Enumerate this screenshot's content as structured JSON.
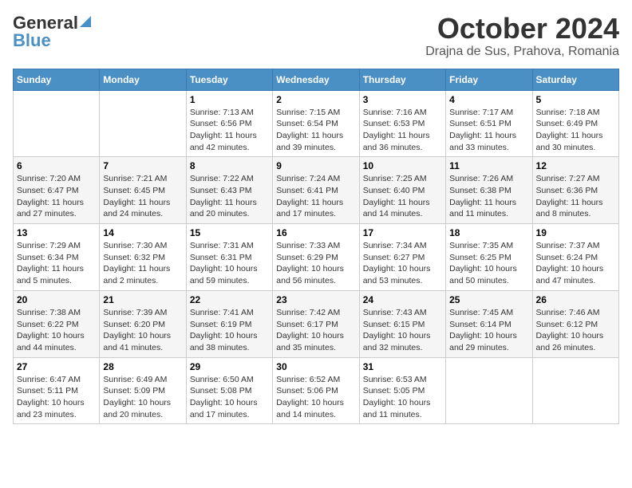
{
  "header": {
    "logo_line1": "General",
    "logo_line2": "Blue",
    "month": "October 2024",
    "location": "Drajna de Sus, Prahova, Romania"
  },
  "days_of_week": [
    "Sunday",
    "Monday",
    "Tuesday",
    "Wednesday",
    "Thursday",
    "Friday",
    "Saturday"
  ],
  "weeks": [
    [
      {
        "day": "",
        "info": ""
      },
      {
        "day": "",
        "info": ""
      },
      {
        "day": "1",
        "info": "Sunrise: 7:13 AM\nSunset: 6:56 PM\nDaylight: 11 hours and 42 minutes."
      },
      {
        "day": "2",
        "info": "Sunrise: 7:15 AM\nSunset: 6:54 PM\nDaylight: 11 hours and 39 minutes."
      },
      {
        "day": "3",
        "info": "Sunrise: 7:16 AM\nSunset: 6:53 PM\nDaylight: 11 hours and 36 minutes."
      },
      {
        "day": "4",
        "info": "Sunrise: 7:17 AM\nSunset: 6:51 PM\nDaylight: 11 hours and 33 minutes."
      },
      {
        "day": "5",
        "info": "Sunrise: 7:18 AM\nSunset: 6:49 PM\nDaylight: 11 hours and 30 minutes."
      }
    ],
    [
      {
        "day": "6",
        "info": "Sunrise: 7:20 AM\nSunset: 6:47 PM\nDaylight: 11 hours and 27 minutes."
      },
      {
        "day": "7",
        "info": "Sunrise: 7:21 AM\nSunset: 6:45 PM\nDaylight: 11 hours and 24 minutes."
      },
      {
        "day": "8",
        "info": "Sunrise: 7:22 AM\nSunset: 6:43 PM\nDaylight: 11 hours and 20 minutes."
      },
      {
        "day": "9",
        "info": "Sunrise: 7:24 AM\nSunset: 6:41 PM\nDaylight: 11 hours and 17 minutes."
      },
      {
        "day": "10",
        "info": "Sunrise: 7:25 AM\nSunset: 6:40 PM\nDaylight: 11 hours and 14 minutes."
      },
      {
        "day": "11",
        "info": "Sunrise: 7:26 AM\nSunset: 6:38 PM\nDaylight: 11 hours and 11 minutes."
      },
      {
        "day": "12",
        "info": "Sunrise: 7:27 AM\nSunset: 6:36 PM\nDaylight: 11 hours and 8 minutes."
      }
    ],
    [
      {
        "day": "13",
        "info": "Sunrise: 7:29 AM\nSunset: 6:34 PM\nDaylight: 11 hours and 5 minutes."
      },
      {
        "day": "14",
        "info": "Sunrise: 7:30 AM\nSunset: 6:32 PM\nDaylight: 11 hours and 2 minutes."
      },
      {
        "day": "15",
        "info": "Sunrise: 7:31 AM\nSunset: 6:31 PM\nDaylight: 10 hours and 59 minutes."
      },
      {
        "day": "16",
        "info": "Sunrise: 7:33 AM\nSunset: 6:29 PM\nDaylight: 10 hours and 56 minutes."
      },
      {
        "day": "17",
        "info": "Sunrise: 7:34 AM\nSunset: 6:27 PM\nDaylight: 10 hours and 53 minutes."
      },
      {
        "day": "18",
        "info": "Sunrise: 7:35 AM\nSunset: 6:25 PM\nDaylight: 10 hours and 50 minutes."
      },
      {
        "day": "19",
        "info": "Sunrise: 7:37 AM\nSunset: 6:24 PM\nDaylight: 10 hours and 47 minutes."
      }
    ],
    [
      {
        "day": "20",
        "info": "Sunrise: 7:38 AM\nSunset: 6:22 PM\nDaylight: 10 hours and 44 minutes."
      },
      {
        "day": "21",
        "info": "Sunrise: 7:39 AM\nSunset: 6:20 PM\nDaylight: 10 hours and 41 minutes."
      },
      {
        "day": "22",
        "info": "Sunrise: 7:41 AM\nSunset: 6:19 PM\nDaylight: 10 hours and 38 minutes."
      },
      {
        "day": "23",
        "info": "Sunrise: 7:42 AM\nSunset: 6:17 PM\nDaylight: 10 hours and 35 minutes."
      },
      {
        "day": "24",
        "info": "Sunrise: 7:43 AM\nSunset: 6:15 PM\nDaylight: 10 hours and 32 minutes."
      },
      {
        "day": "25",
        "info": "Sunrise: 7:45 AM\nSunset: 6:14 PM\nDaylight: 10 hours and 29 minutes."
      },
      {
        "day": "26",
        "info": "Sunrise: 7:46 AM\nSunset: 6:12 PM\nDaylight: 10 hours and 26 minutes."
      }
    ],
    [
      {
        "day": "27",
        "info": "Sunrise: 6:47 AM\nSunset: 5:11 PM\nDaylight: 10 hours and 23 minutes."
      },
      {
        "day": "28",
        "info": "Sunrise: 6:49 AM\nSunset: 5:09 PM\nDaylight: 10 hours and 20 minutes."
      },
      {
        "day": "29",
        "info": "Sunrise: 6:50 AM\nSunset: 5:08 PM\nDaylight: 10 hours and 17 minutes."
      },
      {
        "day": "30",
        "info": "Sunrise: 6:52 AM\nSunset: 5:06 PM\nDaylight: 10 hours and 14 minutes."
      },
      {
        "day": "31",
        "info": "Sunrise: 6:53 AM\nSunset: 5:05 PM\nDaylight: 10 hours and 11 minutes."
      },
      {
        "day": "",
        "info": ""
      },
      {
        "day": "",
        "info": ""
      }
    ]
  ]
}
